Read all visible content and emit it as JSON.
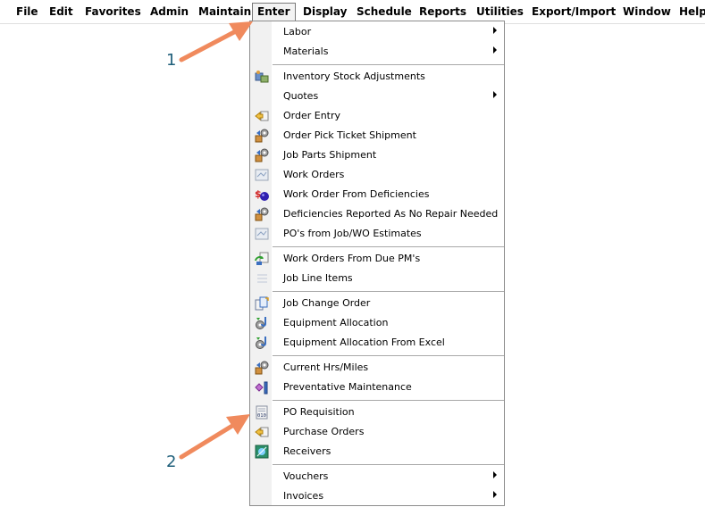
{
  "menubar": {
    "items": [
      "File",
      "Edit",
      "Favorites",
      "Admin",
      "Maintain",
      "Enter",
      "Display",
      "Schedule",
      "Reports",
      "Utilities",
      "Export/Import",
      "Window",
      "Help"
    ],
    "active": "Enter"
  },
  "enter_menu": {
    "items": [
      {
        "label": "Labor",
        "submenu": true,
        "icon": ""
      },
      {
        "label": "Materials",
        "submenu": true,
        "icon": ""
      },
      {
        "label": "Inventory Stock Adjustments",
        "submenu": false,
        "icon": "inventory-icon"
      },
      {
        "label": "Quotes",
        "submenu": true,
        "icon": ""
      },
      {
        "label": "Order Entry",
        "submenu": false,
        "icon": "order-entry-icon"
      },
      {
        "label": "Order Pick Ticket Shipment",
        "submenu": false,
        "icon": "shipment-gear-icon"
      },
      {
        "label": "Job Parts Shipment",
        "submenu": false,
        "icon": "shipment-gear-icon"
      },
      {
        "label": "Work Orders",
        "submenu": false,
        "icon": "work-order-icon"
      },
      {
        "label": "Work Order From Deficiencies",
        "submenu": false,
        "icon": "deficiency-icon"
      },
      {
        "label": "Deficiencies Reported As No Repair Needed",
        "submenu": false,
        "icon": "shipment-gear-icon"
      },
      {
        "label": "PO's from Job/WO Estimates",
        "submenu": false,
        "icon": "work-order-icon"
      },
      {
        "label": "Work Orders From Due PM's",
        "submenu": false,
        "icon": "due-pm-icon"
      },
      {
        "label": "Job Line Items",
        "submenu": false,
        "icon": "line-items-icon"
      },
      {
        "label": "Job Change Order",
        "submenu": false,
        "icon": "change-order-icon"
      },
      {
        "label": "Equipment Allocation",
        "submenu": false,
        "icon": "equipment-icon"
      },
      {
        "label": "Equipment Allocation From Excel",
        "submenu": false,
        "icon": "equipment-icon"
      },
      {
        "label": "Current Hrs/Miles",
        "submenu": false,
        "icon": "shipment-gear-icon"
      },
      {
        "label": "Preventative Maintenance",
        "submenu": false,
        "icon": "pm-icon"
      },
      {
        "label": "PO Requisition",
        "submenu": false,
        "icon": "po-requisition-icon"
      },
      {
        "label": "Purchase Orders",
        "submenu": false,
        "icon": "order-entry-icon"
      },
      {
        "label": "Receivers",
        "submenu": false,
        "icon": "receivers-icon"
      },
      {
        "label": "Vouchers",
        "submenu": true,
        "icon": ""
      },
      {
        "label": "Invoices",
        "submenu": true,
        "icon": ""
      }
    ]
  },
  "annotations": {
    "one": "1",
    "two": "2",
    "arrow_color": "#f08a5d",
    "number_color": "#1f5f7a"
  }
}
